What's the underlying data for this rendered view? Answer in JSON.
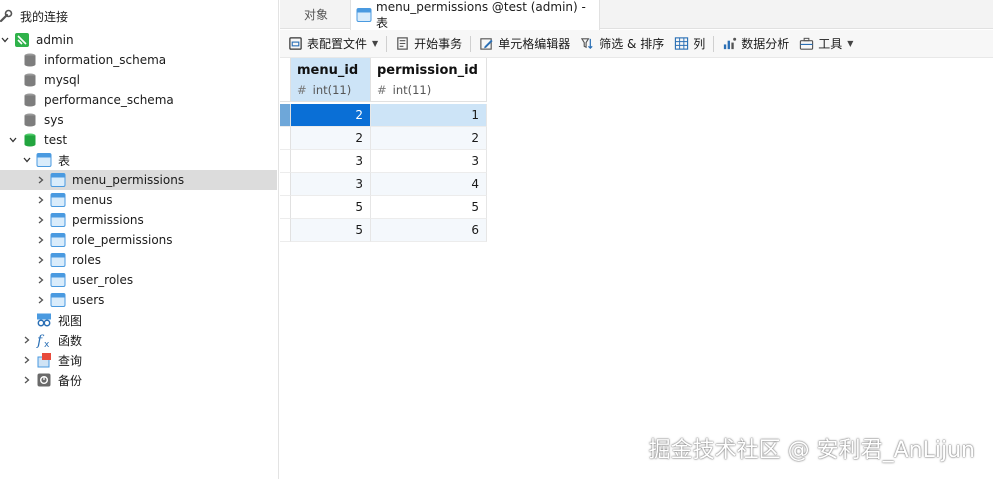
{
  "sidebar": {
    "root": "我的连接",
    "connection": "admin",
    "databases": [
      "information_schema",
      "mysql",
      "performance_schema",
      "sys"
    ],
    "open_db": "test",
    "tables_group": "表",
    "tables": [
      "menu_permissions",
      "menus",
      "permissions",
      "role_permissions",
      "roles",
      "user_roles",
      "users"
    ],
    "views": "视图",
    "functions": "函数",
    "queries": "查询",
    "backups": "备份"
  },
  "tabs": [
    {
      "label": "对象"
    },
    {
      "label": "menu_permissions @test (admin) - 表"
    }
  ],
  "toolbar": {
    "profile": "表配置文件",
    "begin_tx": "开始事务",
    "cell_editor": "单元格编辑器",
    "filter_sort": "筛选 & 排序",
    "columns": "列",
    "analysis": "数据分析",
    "tools": "工具"
  },
  "grid": {
    "columns": [
      {
        "name": "menu_id",
        "type": "int(11)"
      },
      {
        "name": "permission_id",
        "type": "int(11)"
      }
    ],
    "rows": [
      [
        "2",
        "1"
      ],
      [
        "2",
        "2"
      ],
      [
        "3",
        "3"
      ],
      [
        "3",
        "4"
      ],
      [
        "5",
        "5"
      ],
      [
        "5",
        "6"
      ]
    ]
  },
  "watermark": "掘金技术社区 @ 安利君_AnLijun"
}
